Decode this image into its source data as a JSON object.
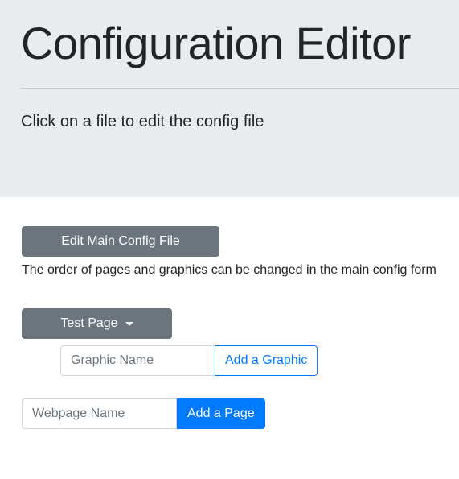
{
  "header": {
    "title": "Configuration Editor",
    "lead": "Click on a file to edit the config file"
  },
  "main": {
    "edit_main_label": "Edit Main Config File",
    "help_text": "The order of pages and graphics can be changed in the main config form",
    "page_dropdown_label": "Test Page",
    "graphic": {
      "placeholder": "Graphic Name",
      "button_label": "Add a Graphic"
    },
    "page": {
      "placeholder": "Webpage Name",
      "button_label": "Add a Page"
    }
  },
  "colors": {
    "jumbotron_bg": "#e9ecef",
    "secondary": "#6c757d",
    "primary": "#007bff"
  }
}
